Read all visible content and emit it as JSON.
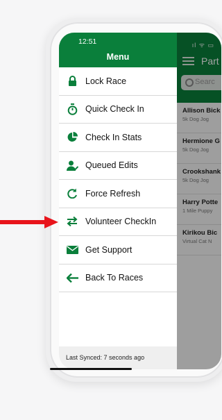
{
  "status_bar": {
    "time": "12:51",
    "indicators": "ıl ᯤ ▭"
  },
  "drawer": {
    "title": "Menu",
    "items": [
      {
        "label": "Lock Race",
        "icon": "lock-icon"
      },
      {
        "label": "Quick Check In",
        "icon": "stopwatch-icon"
      },
      {
        "label": "Check In Stats",
        "icon": "pie-chart-icon"
      },
      {
        "label": "Queued Edits",
        "icon": "user-check-icon"
      },
      {
        "label": "Force Refresh",
        "icon": "refresh-icon"
      },
      {
        "label": "Volunteer CheckIn",
        "icon": "swap-arrows-icon"
      },
      {
        "label": "Get Support",
        "icon": "envelope-icon"
      },
      {
        "label": "Back To Races",
        "icon": "back-arrow-icon"
      }
    ],
    "footer": "Last Synced: 7 seconds ago"
  },
  "background": {
    "title": "Part",
    "search_placeholder": "Searc",
    "rows": [
      {
        "name": "Allison Bick",
        "event": "5k Dog Jog"
      },
      {
        "name": "Hermione G",
        "event": "5k Dog Jog"
      },
      {
        "name": "Crookshank",
        "event": "5k Dog Jog"
      },
      {
        "name": "Harry Potte",
        "event": "1 Mile Puppy"
      },
      {
        "name": "Kirikou Bic",
        "event": "Virtual Cat N"
      }
    ]
  },
  "colors": {
    "brand_green": "#0a7f3b",
    "annotation_arrow": "#e8141b"
  }
}
